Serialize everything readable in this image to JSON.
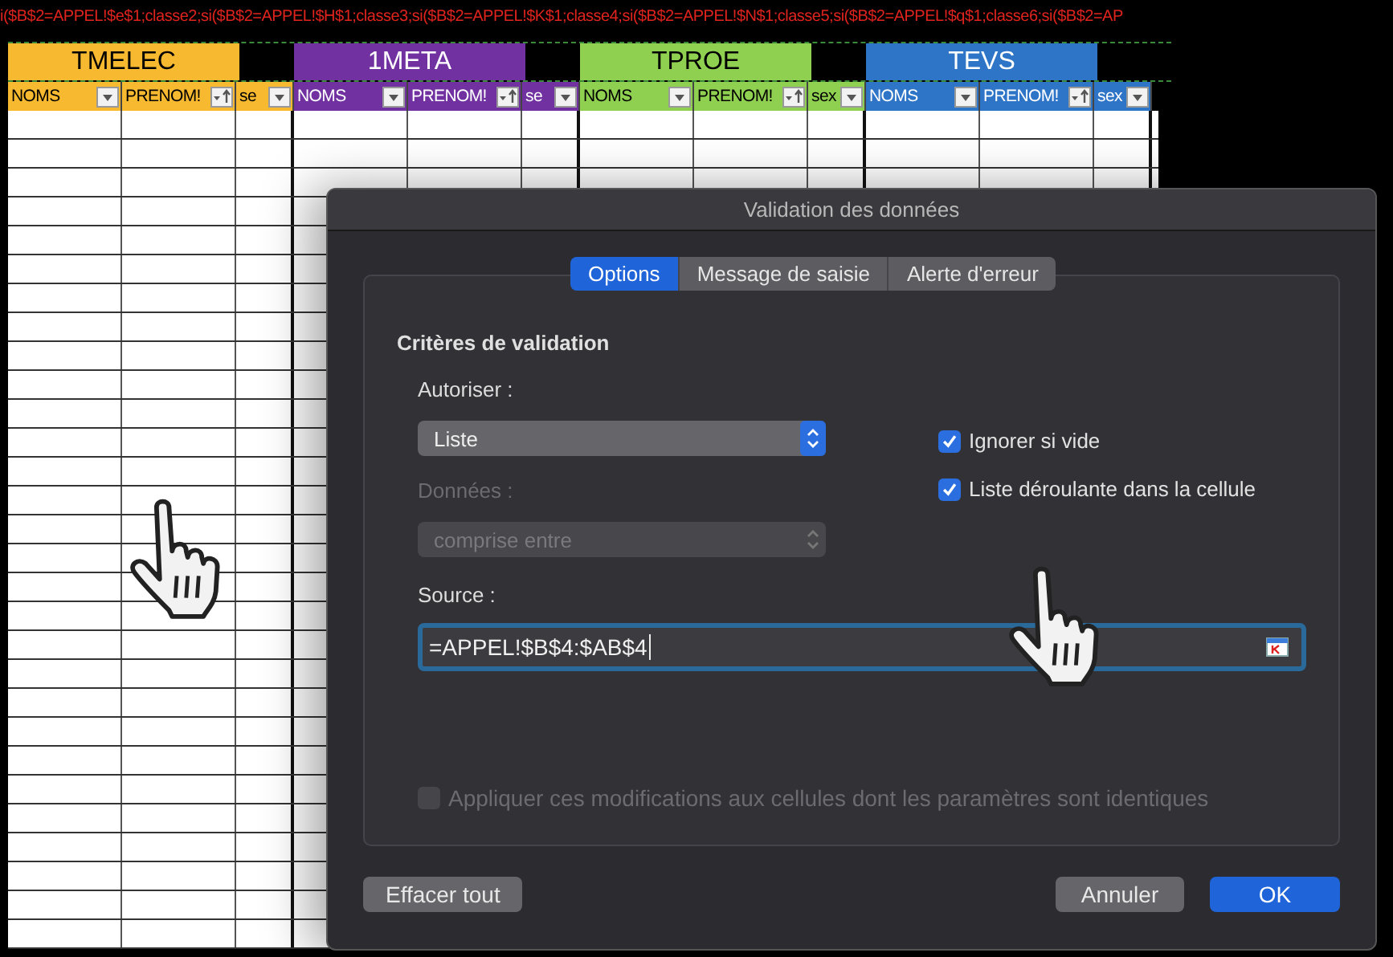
{
  "formula_bar": {
    "text": "i($B$2=APPEL!$e$1;classe2;si($B$2=APPEL!$H$1;classe3;si($B$2=APPEL!$K$1;classe4;si($B$2=APPEL!$N$1;classe5;si($B$2=APPEL!$q$1;classe6;si($B$2=AP"
  },
  "sheet": {
    "groups": [
      {
        "title": "TMELEC",
        "color": "#f6b92f",
        "columns": [
          {
            "label": "NOMS",
            "kind": "filter"
          },
          {
            "label": "PRENOM!",
            "kind": "sort"
          },
          {
            "label": "se",
            "kind": "filter"
          }
        ]
      },
      {
        "title": "1META",
        "color": "#7131a1",
        "columns": [
          {
            "label": "NOMS",
            "kind": "filter"
          },
          {
            "label": "PRENOM!",
            "kind": "sort"
          },
          {
            "label": "se",
            "kind": "filter"
          }
        ]
      },
      {
        "title": "TPROE",
        "color": "#8fd050",
        "columns": [
          {
            "label": "NOMS",
            "kind": "filter"
          },
          {
            "label": "PRENOM!",
            "kind": "sort"
          },
          {
            "label": "sex",
            "kind": "filter"
          }
        ]
      },
      {
        "title": "TEVS",
        "color": "#2e75c7",
        "columns": [
          {
            "label": "NOMS",
            "kind": "filter"
          },
          {
            "label": "PRENOM!",
            "kind": "sort"
          },
          {
            "label": "sex",
            "kind": "filter"
          }
        ]
      }
    ]
  },
  "dialog": {
    "title": "Validation des données",
    "tabs": [
      {
        "label": "Options",
        "selected": true
      },
      {
        "label": "Message de saisie",
        "selected": false
      },
      {
        "label": "Alerte d'erreur",
        "selected": false
      }
    ],
    "section_title": "Critères de validation",
    "allow": {
      "label": "Autoriser :",
      "value": "Liste",
      "disabled": false
    },
    "data": {
      "label": "Données :",
      "value": "comprise entre",
      "disabled": true
    },
    "checkboxes": [
      {
        "label": "Ignorer si vide",
        "checked": true,
        "disabled": false
      },
      {
        "label": "Liste déroulante dans la cellule",
        "checked": true,
        "disabled": false
      }
    ],
    "source": {
      "label": "Source :",
      "value": "=APPEL!$B$4:$AB$4"
    },
    "apply": {
      "label": "Appliquer ces modifications aux cellules dont les paramètres sont identiques",
      "checked": false,
      "disabled": true
    },
    "left_button": {
      "label": "Effacer tout"
    },
    "buttons": [
      {
        "label": "Annuler",
        "kind": "secondary"
      },
      {
        "label": "OK",
        "kind": "default"
      }
    ]
  }
}
